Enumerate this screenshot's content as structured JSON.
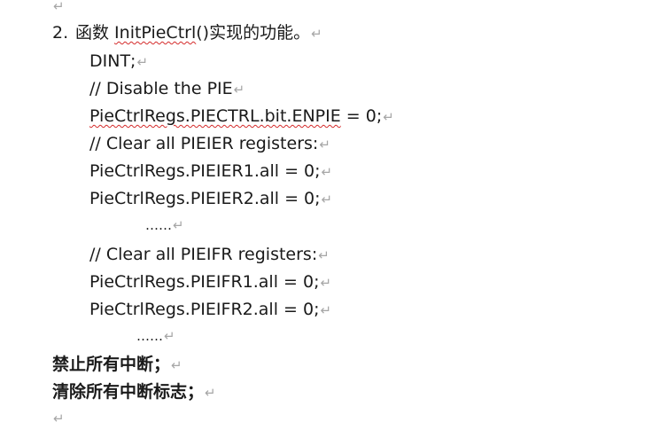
{
  "paragraph_mark": "↵",
  "heading": {
    "number": "2.",
    "prefix": "函数 ",
    "func_name": "InitPieCtrl",
    "suffix": "()实现的功能。"
  },
  "code_lines": {
    "dint": "DINT;",
    "comment_disable": "// Disable the PIE",
    "enpie_code": "PieCtrlRegs.PIECTRL.bit.ENPIE",
    "enpie_assign": " = 0;",
    "comment_clear_ier": "// Clear all PIEIER registers:",
    "ier1": "PieCtrlRegs.PIEIER1.all = 0;",
    "ier2": "PieCtrlRegs.PIEIER2.all = 0;",
    "ellipsis_1": "……",
    "comment_clear_ifr": "// Clear all PIEIFR registers:",
    "ifr1": "PieCtrlRegs.PIEIFR1.all = 0;",
    "ifr2": "PieCtrlRegs.PIEIFR2.all = 0;",
    "ellipsis_2": "……"
  },
  "answers": {
    "line1": "禁止所有中断；",
    "line2": "清除所有中断标志；"
  }
}
